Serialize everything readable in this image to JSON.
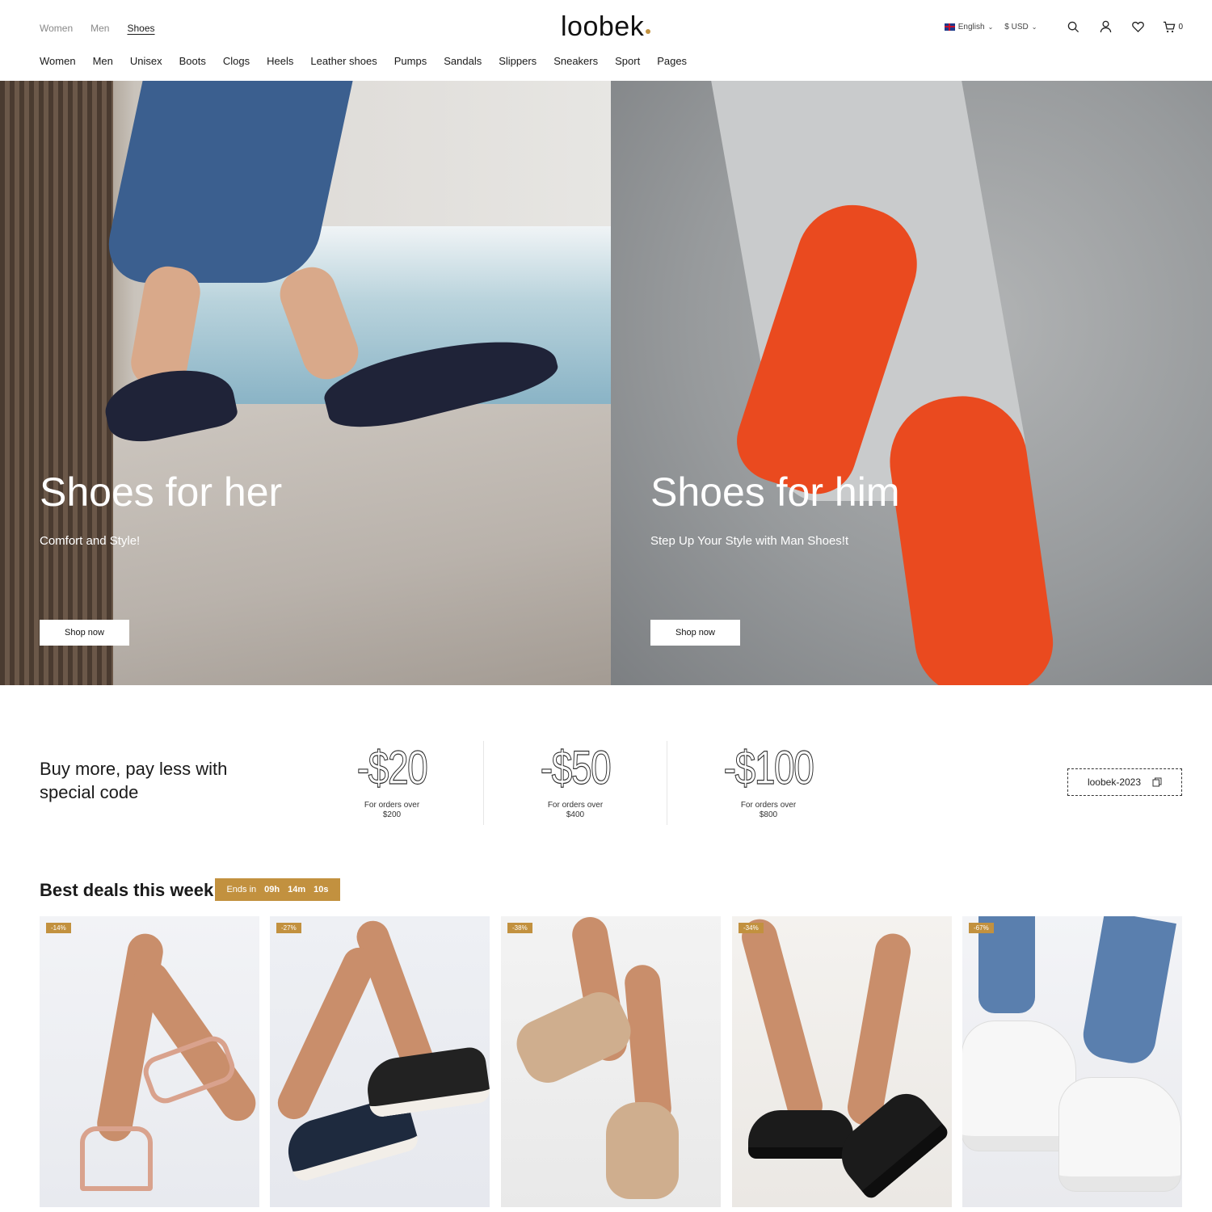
{
  "brand": {
    "logo": "loobek"
  },
  "top_links": [
    "Women",
    "Men",
    "Shoes"
  ],
  "top_links_active": "Shoes",
  "locale": {
    "language": "English",
    "currency": "$ USD"
  },
  "cart": {
    "count": "0"
  },
  "main_nav": [
    "Women",
    "Men",
    "Unisex",
    "Boots",
    "Clogs",
    "Heels",
    "Leather shoes",
    "Pumps",
    "Sandals",
    "Slippers",
    "Sneakers",
    "Sport",
    "Pages"
  ],
  "hero": [
    {
      "title": "Shoes for her",
      "subtitle": "Comfort and Style!",
      "button": "Shop now"
    },
    {
      "title": "Shoes for him",
      "subtitle": "Step Up Your Style with Man Shoes!t",
      "button": "Shop now"
    }
  ],
  "promo": {
    "title": "Buy more, pay less with special code",
    "offers": [
      {
        "amount": "-$20",
        "note": "For orders over",
        "threshold": "$200"
      },
      {
        "amount": "-$50",
        "note": "For orders over",
        "threshold": "$400"
      },
      {
        "amount": "-$100",
        "note": "For orders over",
        "threshold": "$800"
      }
    ],
    "code": "loobek-2023"
  },
  "deals": {
    "title": "Best deals this week",
    "ends_label": "Ends in",
    "timer": {
      "hours": "09h",
      "minutes": "14m",
      "seconds": "10s"
    },
    "products": [
      {
        "badge": "-14%"
      },
      {
        "badge": "-27%"
      },
      {
        "badge": "-38%"
      },
      {
        "badge": "-34%"
      },
      {
        "badge": "-67%"
      }
    ]
  },
  "colors": {
    "accent": "#c2913f",
    "sneaker": "#ea4a1f"
  },
  "icons": [
    "search-icon",
    "user-icon",
    "heart-icon",
    "cart-icon",
    "copy-icon",
    "flag-uk-icon"
  ]
}
